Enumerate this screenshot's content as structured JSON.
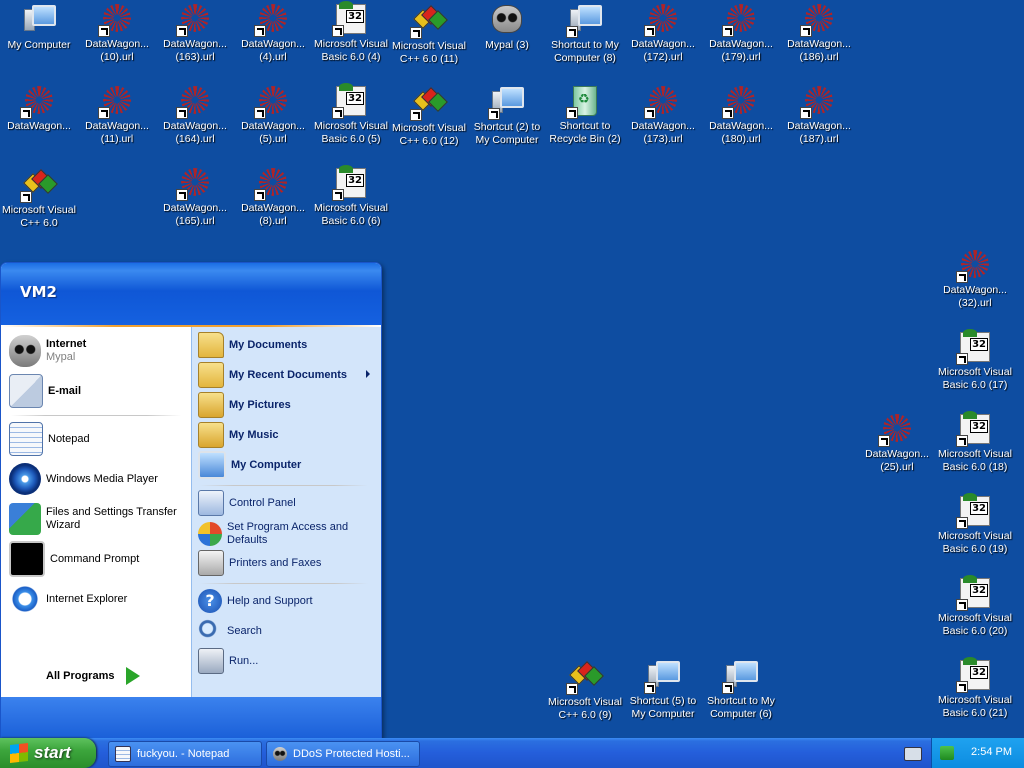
{
  "desktop": {
    "icons": [
      {
        "label": "My Computer",
        "kind": "comp",
        "shortcut": false
      },
      {
        "label": "DataWagon... (10).url",
        "kind": "web",
        "shortcut": true
      },
      {
        "label": "DataWagon... (163).url",
        "kind": "web",
        "shortcut": true
      },
      {
        "label": "DataWagon... (4).url",
        "kind": "web",
        "shortcut": true
      },
      {
        "label": "Microsoft Visual Basic 6.0 (4)",
        "kind": "vb",
        "shortcut": true
      },
      {
        "label": "Microsoft Visual C++ 6.0 (11)",
        "kind": "vc",
        "shortcut": true
      },
      {
        "label": "Mypal (3)",
        "kind": "raccoon",
        "shortcut": false
      },
      {
        "label": "Shortcut to My Computer (8)",
        "kind": "comp",
        "shortcut": true
      },
      {
        "label": "DataWagon... (172).url",
        "kind": "web",
        "shortcut": true
      },
      {
        "label": "DataWagon... (179).url",
        "kind": "web",
        "shortcut": true
      },
      {
        "label": "DataWagon... (186).url",
        "kind": "web",
        "shortcut": true
      },
      {
        "label": "DataWagon...",
        "kind": "web",
        "shortcut": true
      },
      {
        "label": "DataWagon... (11).url",
        "kind": "web",
        "shortcut": true
      },
      {
        "label": "DataWagon... (164).url",
        "kind": "web",
        "shortcut": true
      },
      {
        "label": "DataWagon... (5).url",
        "kind": "web",
        "shortcut": true
      },
      {
        "label": "Microsoft Visual Basic 6.0 (5)",
        "kind": "vb",
        "shortcut": true
      },
      {
        "label": "Microsoft Visual C++ 6.0 (12)",
        "kind": "vc",
        "shortcut": true
      },
      {
        "label": "Shortcut (2) to My Computer",
        "kind": "comp",
        "shortcut": true
      },
      {
        "label": "Shortcut to Recycle Bin (2)",
        "kind": "bin",
        "shortcut": true
      },
      {
        "label": "DataWagon... (173).url",
        "kind": "web",
        "shortcut": true
      },
      {
        "label": "DataWagon... (180).url",
        "kind": "web",
        "shortcut": true
      },
      {
        "label": "DataWagon... (187).url",
        "kind": "web",
        "shortcut": true
      },
      {
        "label": "Microsoft Visual C++ 6.0",
        "kind": "vc",
        "shortcut": true
      },
      {
        "label": "DataWagon... (165).url",
        "kind": "web",
        "shortcut": true
      },
      {
        "label": "DataWagon... (8).url",
        "kind": "web",
        "shortcut": true
      },
      {
        "label": "Microsoft Visual Basic 6.0 (6)",
        "kind": "vb",
        "shortcut": true
      },
      {
        "label": "DataWagon... (32).url",
        "kind": "web",
        "shortcut": true
      },
      {
        "label": "Microsoft Visual Basic 6.0 (17)",
        "kind": "vb",
        "shortcut": true
      },
      {
        "label": "DataWagon... (25).url",
        "kind": "web",
        "shortcut": true
      },
      {
        "label": "Microsoft Visual Basic 6.0 (18)",
        "kind": "vb",
        "shortcut": true
      },
      {
        "label": "Microsoft Visual Basic 6.0 (19)",
        "kind": "vb",
        "shortcut": true
      },
      {
        "label": "Microsoft Visual Basic 6.0 (20)",
        "kind": "vb",
        "shortcut": true
      },
      {
        "label": "Microsoft Visual Basic 6.0 (21)",
        "kind": "vb",
        "shortcut": true
      },
      {
        "label": "Microsoft Visual C++ 6.0 (9)",
        "kind": "vc",
        "shortcut": true
      },
      {
        "label": "Shortcut (5) to My Computer",
        "kind": "comp",
        "shortcut": true
      },
      {
        "label": "Shortcut to My Computer (6)",
        "kind": "comp",
        "shortcut": true
      }
    ]
  },
  "start_menu": {
    "user_name": "VM2",
    "left_items": [
      {
        "title": "Internet",
        "sub": "Mypal",
        "icon": "raccoon-icon",
        "bold": true
      },
      {
        "title": "E-mail",
        "sub": "",
        "icon": "email-icon",
        "bold": true
      },
      {
        "title": "Notepad",
        "sub": "",
        "icon": "notepad-icon",
        "bold": false
      },
      {
        "title": "Windows Media Player",
        "sub": "",
        "icon": "media-player-icon",
        "bold": false
      },
      {
        "title": "Files and Settings Transfer Wizard",
        "sub": "",
        "icon": "transfer-wizard-icon",
        "bold": false
      },
      {
        "title": "Command Prompt",
        "sub": "",
        "icon": "command-prompt-icon",
        "bold": false
      },
      {
        "title": "Internet Explorer",
        "sub": "",
        "icon": "internet-explorer-icon",
        "bold": false
      }
    ],
    "all_programs": "All Programs",
    "right_items": [
      {
        "label": "My Documents",
        "bold": true,
        "icon": "folder-icon"
      },
      {
        "label": "My Recent Documents",
        "bold": true,
        "icon": "recent-docs-icon",
        "submenu": true
      },
      {
        "label": "My Pictures",
        "bold": true,
        "icon": "pictures-folder-icon"
      },
      {
        "label": "My Music",
        "bold": true,
        "icon": "music-folder-icon"
      },
      {
        "label": "My Computer",
        "bold": true,
        "icon": "my-computer-icon"
      },
      {
        "label": "Control Panel",
        "bold": false,
        "icon": "control-panel-icon"
      },
      {
        "label": "Set Program Access and Defaults",
        "bold": false,
        "icon": "program-access-icon"
      },
      {
        "label": "Printers and Faxes",
        "bold": false,
        "icon": "printer-icon"
      },
      {
        "label": "Help and Support",
        "bold": false,
        "icon": "help-icon"
      },
      {
        "label": "Search",
        "bold": false,
        "icon": "search-icon"
      },
      {
        "label": "Run...",
        "bold": false,
        "icon": "run-icon"
      }
    ]
  },
  "taskbar": {
    "start_label": "start",
    "tasks": [
      {
        "label": "fuckyou. - Notepad",
        "icon": "notepad-icon"
      },
      {
        "label": "DDoS Protected Hosti...",
        "icon": "raccoon-icon"
      }
    ],
    "clock": "2:54 PM"
  },
  "colors": {
    "desktop_bg": "#0e4da1",
    "taskbar": "#245edb",
    "start_button": "#3da63d",
    "menu_header": "#1561e0",
    "menu_right_pane": "#d3e5fa"
  }
}
